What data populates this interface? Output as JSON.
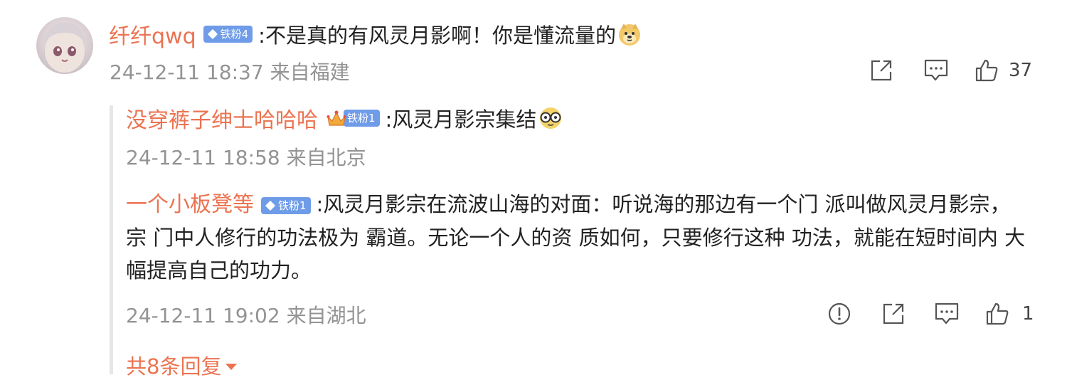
{
  "comment": {
    "username": "纤纤qwq",
    "badge": "铁粉4",
    "text": ":不是真的有风灵月影啊！你是懂流量的",
    "emoji": "doge-emoji",
    "time": "24-12-11 18:37",
    "location": "来自福建",
    "likes": "37"
  },
  "replies": [
    {
      "username": "没穿裤子绅士哈哈哈",
      "badge": "铁粉1",
      "text": ":风灵月影宗集结",
      "emoji": "glasses-emoji",
      "time": "24-12-11 18:58",
      "location": "来自北京"
    },
    {
      "username": "一个小板凳等",
      "badge": "铁粉1",
      "text": ":风灵月影宗在流波山海的对面：听说海的那边有一个门 派叫做风灵月影宗，宗 门中人修行的功法极为 霸道。无论一个人的资 质如何，只要修行这种 功法，就能在短时间内 大幅提高自己的功力。",
      "time": "24-12-11 19:02",
      "location": "来自湖北",
      "likes": "1"
    }
  ],
  "more_replies": "共8条回复",
  "colors": {
    "username": "#eb7350",
    "badge": "#6f9ce8",
    "meta": "#939393"
  }
}
